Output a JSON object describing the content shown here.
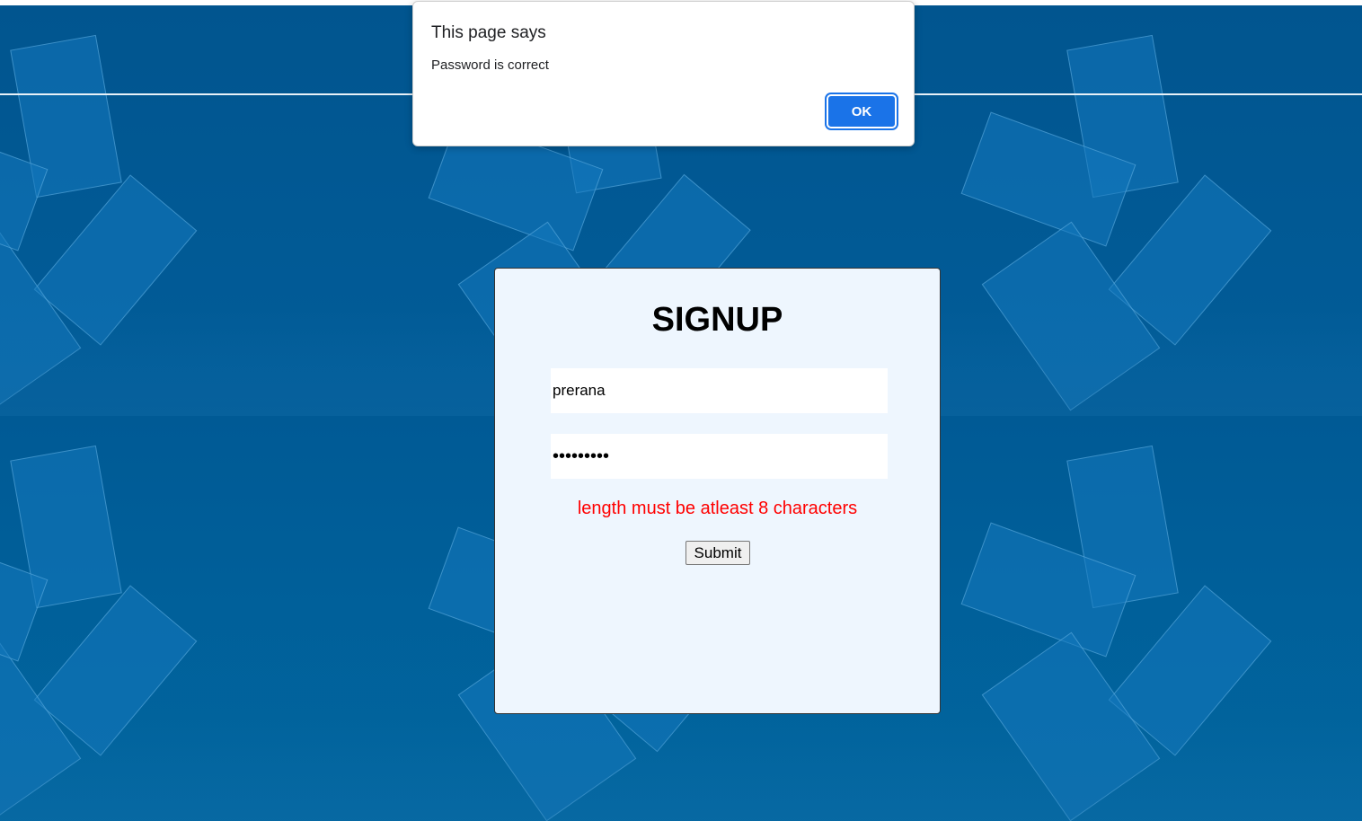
{
  "dialog": {
    "title": "This page says",
    "message": "Password is correct",
    "ok_label": "OK"
  },
  "signup": {
    "title": "SIGNUP",
    "username_value": "prerana",
    "password_masked": "•••••••••",
    "error_message": "length must be atleast 8 characters",
    "submit_label": "Submit"
  },
  "colors": {
    "background_blue": "#015c98",
    "form_background": "#eef6fe",
    "error_red": "#ff0000",
    "ok_button_blue": "#1a73e8"
  }
}
